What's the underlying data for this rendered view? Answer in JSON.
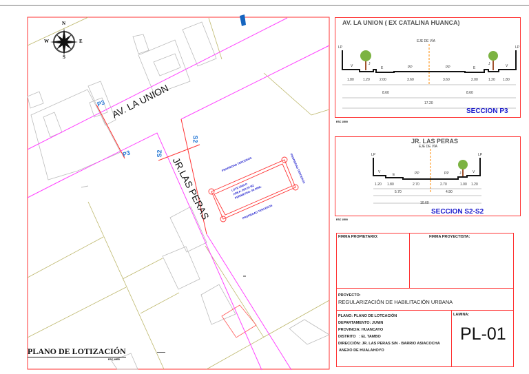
{
  "map": {
    "title": "PLANO DE LOTIZACIÓN",
    "scale": "ESC 1/500",
    "streets": {
      "av": "AV. LA UNION",
      "jr": "JR.LAS PERAS"
    },
    "section_marks": {
      "p3": "P3",
      "s2": "S2"
    },
    "compass": {
      "n": "N",
      "s": "S",
      "e": "E",
      "w": "W"
    },
    "lot": {
      "name": "LOTE UNICO",
      "area": "AREA: 000.00 M2",
      "perimeter": "PERIMETRO: 00.00ML",
      "neighbors": [
        "PROPIEDAD TERCEROS",
        "PROPIEDAD TERCEROS",
        "PROPIEDAD TERCEROS"
      ]
    }
  },
  "section_p3": {
    "title": "AV. LA UNION ( EX CATALINA HUANCA)",
    "axis": "EJE DE VÍA",
    "labels": {
      "lp": "LP",
      "v": "V",
      "j": "J",
      "e": "E",
      "pp": "PP"
    },
    "dims": [
      "1.80",
      "1.20",
      "2.00",
      "3.60",
      "3.60",
      "2.00",
      "1.20",
      "1.80"
    ],
    "halves": [
      "8.60",
      "8.60"
    ],
    "total": "17.20",
    "name": "SECCION P3",
    "scale": "ESC 1/500"
  },
  "section_s2": {
    "title": "JR. LAS PERAS",
    "axis": "EJE DE VÍA",
    "dims": [
      "1.20",
      "1.80",
      "2.70",
      "2.70",
      "1.00",
      "1.20"
    ],
    "halves": [
      "5.70",
      "4.90"
    ],
    "total": "10.60",
    "name": "SECCION S2-S2",
    "scale": "ESC 1/500"
  },
  "title_block": {
    "firma_propietario": "FIRMA PROPIETARIO:",
    "firma_proyectista": "FIRMA PROYECTISTA:",
    "proyecto_label": "PROYECTO:",
    "proyecto": "REGULARIZACIÓN DE HABILITACIÓN URBANA",
    "plano": "PLANO: PLANO DE LOTCACIÓN",
    "departamento": "DEPARTAMENTO: JUNIN",
    "provincia": "PROVINCIA: HUANCAYO",
    "distrito": "DISTRITO   : EL TAMBO",
    "direccion": "DIRECCIÓN: JR. LAS PERAS S/N - BARRIO ASIACOCHA",
    "anexo": "ANEXO DE HUALAHOYO",
    "lamina_label": "LAMINA:",
    "lamina": "PL-01"
  },
  "colors": {
    "frame": "#ff3333",
    "street": "#ff44ff",
    "lot": "#ff3333",
    "text_blue": "#1a1acc",
    "mark_blue": "#2b7bd6"
  }
}
